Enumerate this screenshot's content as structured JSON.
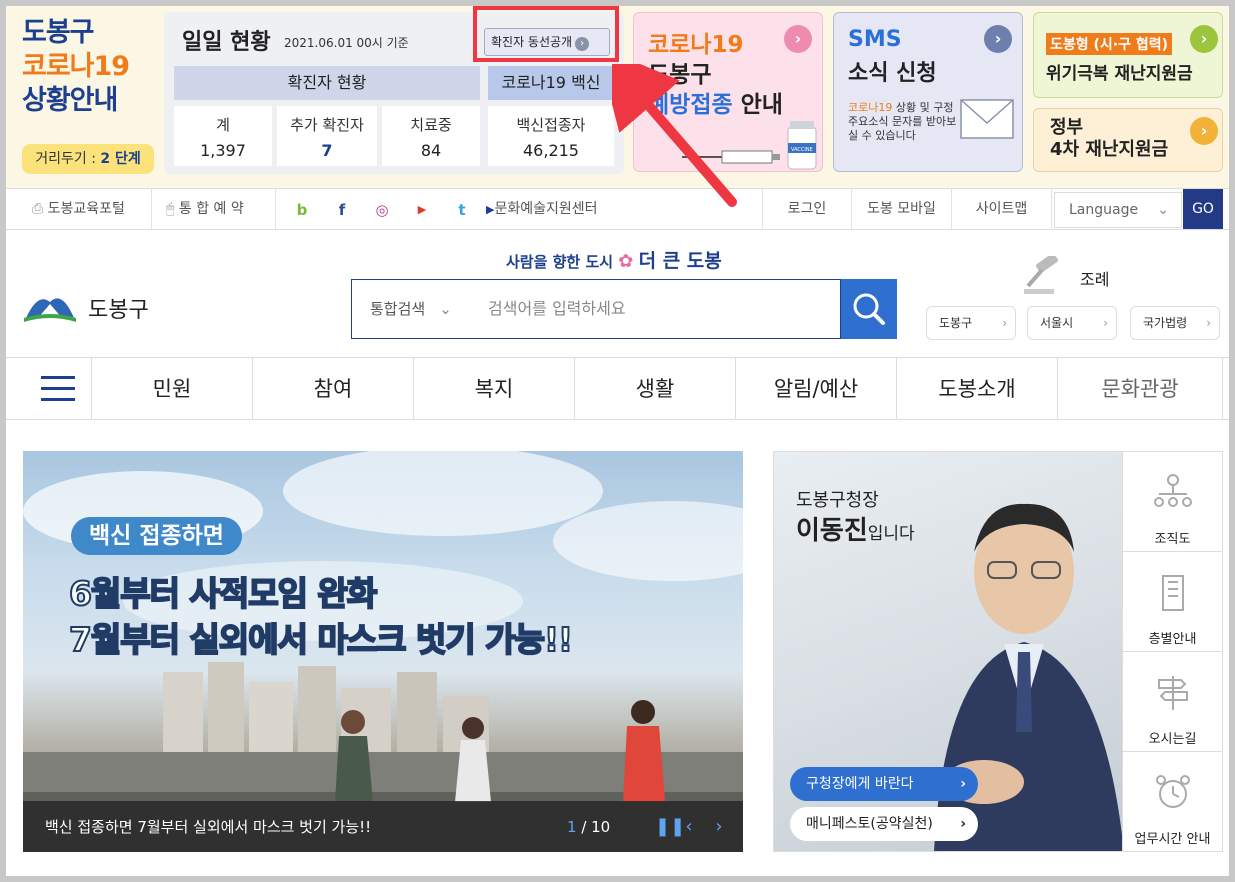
{
  "covid": {
    "title_line1": "도봉구",
    "title_line2": "코로나19",
    "title_line3": "상황안내",
    "distance_label": "거리두기 :",
    "distance_value": "2 단계",
    "daily_title": "일일 현황",
    "daily_date": "2021.06.01 00시 기준",
    "route_button": "확진자 동선공개",
    "header_confirmed": "확진자 현황",
    "header_vaccine": "코로나19 백신",
    "stats": [
      {
        "label": "계",
        "value": "1,397"
      },
      {
        "label": "추가 확진자",
        "value": "7"
      },
      {
        "label": "치료중",
        "value": "84"
      },
      {
        "label": "백신접종자",
        "value": "46,215"
      }
    ]
  },
  "cards": {
    "vaccine": {
      "line1": "코로나19",
      "line2": "도봉구",
      "line3a": "예방접종",
      "line3b": " 안내",
      "vial": "VACCINE"
    },
    "sms": {
      "line1": "SMS",
      "line2": "소식 신청",
      "desc_a": "코로나19",
      "desc_b": " 상황 및 구정 주요소식 문자를 받아보실 수 있습니다"
    },
    "aid1": {
      "tag": "도봉형 (시·구 협력)",
      "text": "위기극복 재난지원금"
    },
    "aid2": {
      "line1": "정부",
      "line2": "4차 재난지원금"
    }
  },
  "topbar": {
    "edu_portal": "도봉교육포털",
    "reservation": "통 합 예 약",
    "culture_center": "문화예술지원센터",
    "login": "로그인",
    "mobile": "도봉 모바일",
    "sitemap": "사이트맵",
    "language": "Language",
    "go": "GO",
    "sns": [
      "b",
      "f",
      "◎",
      "▶",
      "t"
    ]
  },
  "header": {
    "logo_text": "도봉구",
    "slogan_a": "사람을 향한 도시",
    "slogan_b": "더 큰 도봉",
    "search_select": "통합검색",
    "search_placeholder": "검색어를 입력하세요",
    "ordinance": "조례",
    "law_buttons": [
      "도봉구",
      "서울시",
      "국가법령"
    ]
  },
  "gnb": [
    "민원",
    "참여",
    "복지",
    "생활",
    "알림/예산",
    "도봉소개",
    "문화관광"
  ],
  "banner": {
    "tag": "백신 접종하면",
    "headline1": "6월부터 사적모임 완화",
    "headline2": "7월부터 실외에서 마스크 벗기 가능!!",
    "caption": "백신 접종하면 7월부터 실외에서 마스크 벗기 가능!!",
    "page_current": "1",
    "page_total": " / 10"
  },
  "mayor": {
    "line1": "도봉구청장",
    "name": "이동진",
    "suffix": "입니다",
    "btn1": "구청장에게 바란다",
    "btn2": "매니페스토(공약실천)"
  },
  "quick": [
    "조직도",
    "층별안내",
    "오시는길",
    "업무시간 안내"
  ],
  "colors": {
    "brand_blue": "#1d3f8f",
    "accent_orange": "#ef7b1a",
    "highlight_red": "#ef3743",
    "search_blue": "#2e6fcf"
  }
}
